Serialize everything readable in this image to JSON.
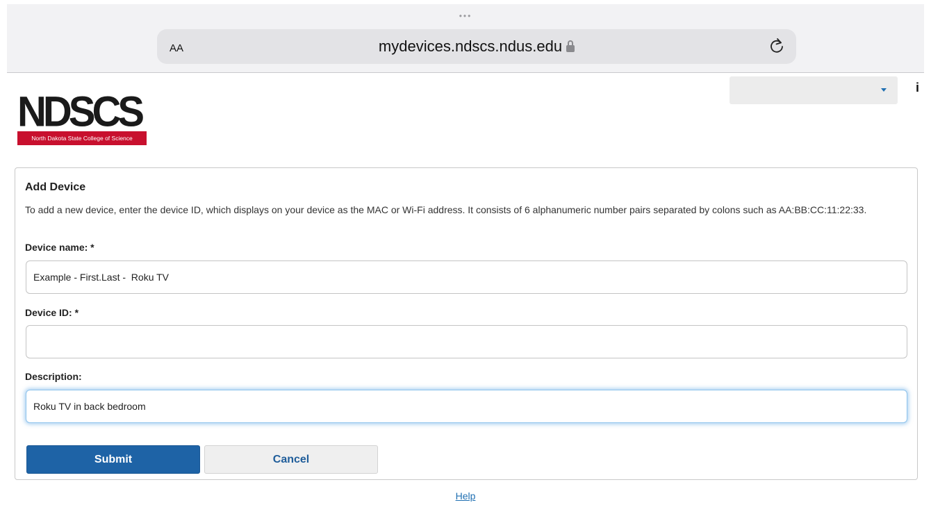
{
  "browser": {
    "dots": "•••",
    "aa_label": "AA",
    "url": "mydevices.ndscs.ndus.edu"
  },
  "header": {
    "logo_text": "NDSCS",
    "logo_tagline": "North Dakota State College of Science",
    "language_select_value": "",
    "info_label": "i"
  },
  "form": {
    "title": "Add Device",
    "description": "To add a new device, enter the device ID, which displays on your device as the MAC or Wi-Fi address. It consists of 6 alphanumeric number pairs separated by colons such as AA:BB:CC:11:22:33.",
    "device_name_label": "Device name: *",
    "device_name_value": "Example - First.Last -  Roku TV",
    "device_id_label": "Device ID: *",
    "device_id_value": "",
    "description_label": "Description:",
    "description_value": "Roku TV in back bedroom",
    "submit_label": "Submit",
    "cancel_label": "Cancel"
  },
  "footer": {
    "help_label": "Help"
  },
  "colors": {
    "primary_button": "#1e63a6",
    "logo_banner": "#c8102e",
    "link": "#1f6fb2",
    "focus_glow": "#8ec3ec"
  }
}
